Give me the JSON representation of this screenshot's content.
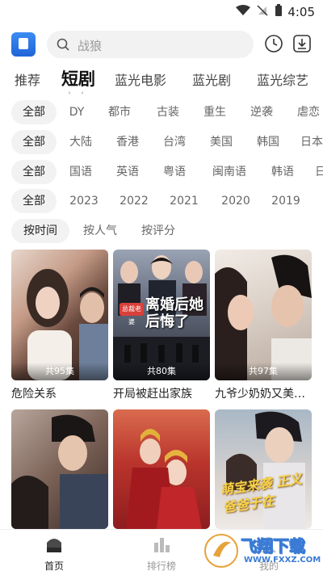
{
  "status": {
    "time": "4:05"
  },
  "search": {
    "placeholder": "战狼"
  },
  "tabs": [
    "推荐",
    "短剧",
    "蓝光电影",
    "蓝光剧",
    "蓝光综艺"
  ],
  "filters": {
    "type": [
      "全部",
      "DY",
      "都市",
      "古装",
      "重生",
      "逆袭",
      "虐恋"
    ],
    "region": [
      "全部",
      "大陆",
      "香港",
      "台湾",
      "美国",
      "韩国",
      "日本"
    ],
    "language": [
      "全部",
      "国语",
      "英语",
      "粤语",
      "闽南语",
      "韩语",
      "日"
    ],
    "year": [
      "全部",
      "2023",
      "2022",
      "2021",
      "2020",
      "2019"
    ],
    "sort": [
      "按时间",
      "按人气",
      "按评分"
    ]
  },
  "cards": [
    {
      "title": "危险关系",
      "episodes": "共95集"
    },
    {
      "title": "开局被赶出家族",
      "episodes": "共80集",
      "poster_text": "离婚后她后悔了",
      "poster_tag": "总裁老婆"
    },
    {
      "title": "九爷少奶奶又美又飒",
      "episodes": "共97集"
    },
    {
      "title": "",
      "episodes": ""
    },
    {
      "title": "",
      "episodes": ""
    },
    {
      "title": "",
      "episodes": "",
      "poster_text": "萌宝来袭 正义爸爸于在"
    }
  ],
  "bottom_nav": [
    {
      "label": "首页"
    },
    {
      "label": "排行榜"
    },
    {
      "label": "我的"
    }
  ],
  "watermark": {
    "text": "飞翔下载",
    "url": "WWW.FXXZ.COM"
  },
  "colors": {
    "accent": "#1f64d8",
    "chip_bg": "#f2f2f2"
  }
}
